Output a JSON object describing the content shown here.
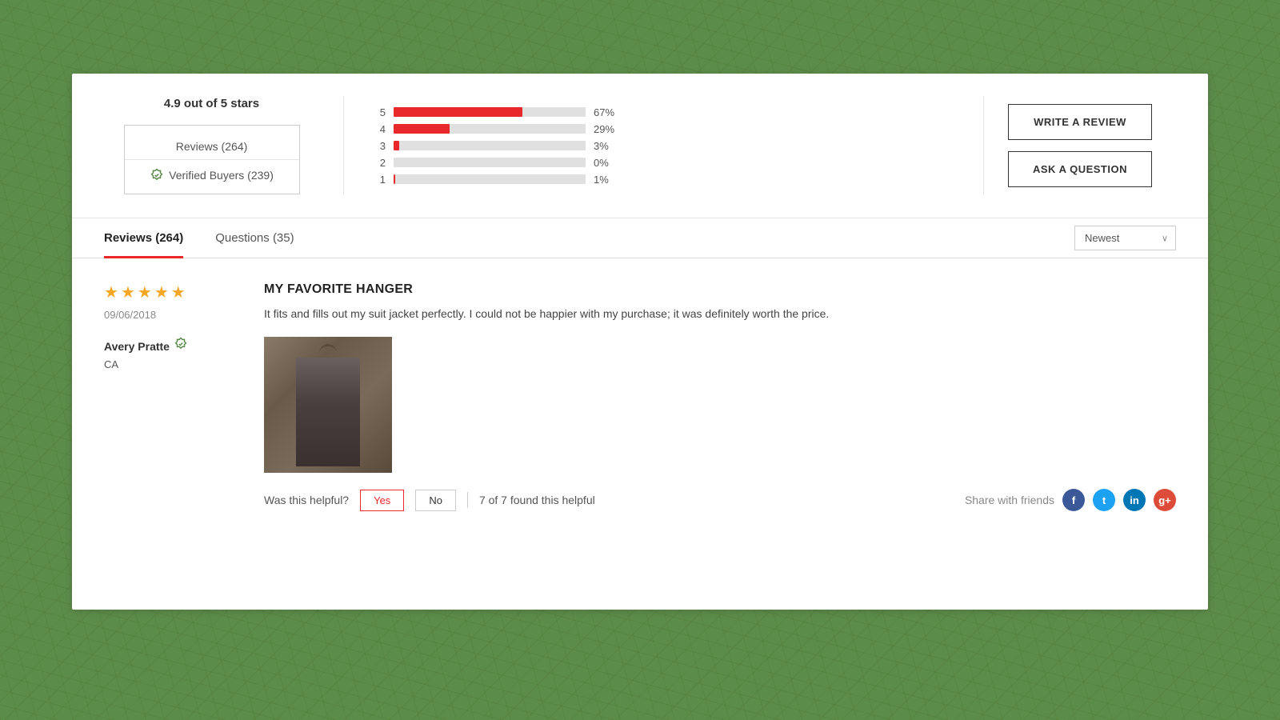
{
  "background": {
    "color": "#5c8a48"
  },
  "summary": {
    "rating_text": "4.9 out of 5 stars",
    "reviews_count": "Reviews (264)",
    "verified_buyers": "Verified Buyers (239)",
    "bars": [
      {
        "label": "5",
        "pct": 67,
        "pct_text": "67%"
      },
      {
        "label": "4",
        "pct": 29,
        "pct_text": "29%"
      },
      {
        "label": "3",
        "pct": 3,
        "pct_text": "3%"
      },
      {
        "label": "2",
        "pct": 0,
        "pct_text": "0%"
      },
      {
        "label": "1",
        "pct": 1,
        "pct_text": "1%"
      }
    ],
    "write_review_label": "WRITE A REVIEW",
    "ask_question_label": "ASK A QUESTION"
  },
  "tabs": {
    "reviews_tab": "Reviews (264)",
    "questions_tab": "Questions (35)",
    "sort_label": "Newest"
  },
  "review": {
    "stars": 5,
    "date": "09/06/2018",
    "author": "Avery Pratte",
    "location": "CA",
    "title": "MY FAVORITE HANGER",
    "body": "It fits and fills out my suit jacket perfectly. I could not be happier with my purchase; it was definitely worth the price.",
    "helpful_label": "Was this helpful?",
    "yes_label": "Yes",
    "no_label": "No",
    "helpful_count": "7 of 7 found this helpful",
    "share_label": "Share with friends"
  }
}
